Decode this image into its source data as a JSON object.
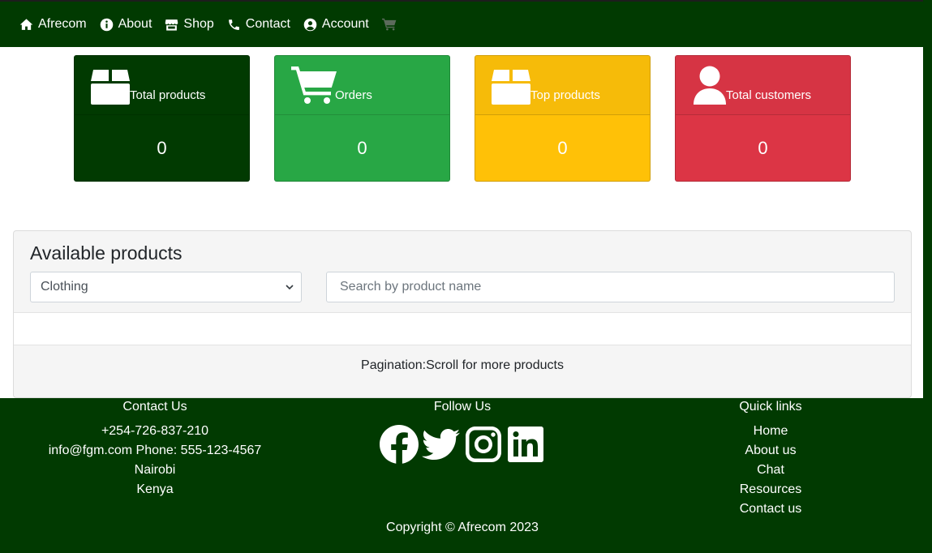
{
  "nav": {
    "brand": "Afrecom",
    "items": [
      {
        "label": "About",
        "icon": "info-circle-icon"
      },
      {
        "label": "Shop",
        "icon": "store-icon"
      },
      {
        "label": "Contact",
        "icon": "phone-icon"
      },
      {
        "label": "Account",
        "icon": "user-circle-icon"
      }
    ],
    "cart_icon": "shopping-cart-icon"
  },
  "stats": [
    {
      "title": "Total products",
      "value": "0",
      "icon": "box-icon",
      "color": "#013a01"
    },
    {
      "title": "Orders",
      "value": "0",
      "icon": "shopping-cart-icon",
      "color": "#28a745"
    },
    {
      "title": "Top products",
      "value": "0",
      "icon": "box-icon",
      "color": "#ffc107"
    },
    {
      "title": "Total customers",
      "value": "0",
      "icon": "user-icon",
      "color": "#dc3545"
    }
  ],
  "products": {
    "heading": "Available products",
    "category_selected": "Clothing",
    "search_placeholder": "Search by product name",
    "pagination_note": "Pagination:Scroll for more products"
  },
  "footer": {
    "contact": {
      "title": "Contact Us",
      "lines": [
        "+254-726-837-210",
        "info@fgm.com Phone: 555-123-4567",
        "Nairobi",
        "Kenya"
      ]
    },
    "follow": {
      "title": "Follow Us",
      "networks": [
        "facebook-icon",
        "twitter-icon",
        "instagram-icon",
        "linkedin-icon"
      ]
    },
    "links": {
      "title": "Quick links",
      "items": [
        "Home",
        "About us",
        "Chat",
        "Resources",
        "Contact us"
      ]
    },
    "copyright": "Copyright © Afrecom 2023"
  },
  "colors": {
    "brand_dark_green": "#013a01",
    "success": "#28a745",
    "warning": "#ffc107",
    "danger": "#dc3545"
  }
}
